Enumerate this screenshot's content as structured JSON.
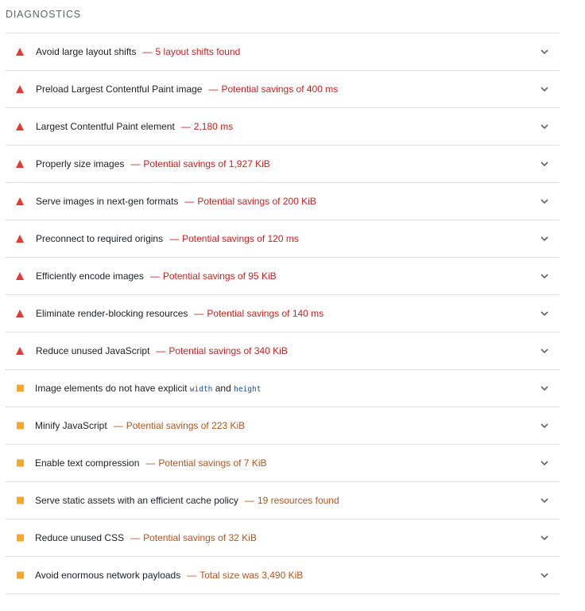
{
  "section": {
    "title": "DIAGNOSTICS"
  },
  "colors": {
    "fail": "#e53935",
    "warn": "#f9a825",
    "fail_text": "#c5221f",
    "warn_text": "#b3541e"
  },
  "audits": [
    {
      "status": "fail",
      "title": "Avoid large layout shifts",
      "separator": "—",
      "display_value": "5 layout shifts found"
    },
    {
      "status": "fail",
      "title": "Preload Largest Contentful Paint image",
      "separator": "—",
      "display_value": "Potential savings of 400 ms"
    },
    {
      "status": "fail",
      "title": "Largest Contentful Paint element",
      "separator": "—",
      "display_value": "2,180 ms"
    },
    {
      "status": "fail",
      "title": "Properly size images",
      "separator": "—",
      "display_value": "Potential savings of 1,927 KiB"
    },
    {
      "status": "fail",
      "title": "Serve images in next-gen formats",
      "separator": "—",
      "display_value": "Potential savings of 200 KiB"
    },
    {
      "status": "fail",
      "title": "Preconnect to required origins",
      "separator": "—",
      "display_value": "Potential savings of 120 ms"
    },
    {
      "status": "fail",
      "title": "Efficiently encode images",
      "separator": "—",
      "display_value": "Potential savings of 95 KiB"
    },
    {
      "status": "fail",
      "title": "Eliminate render-blocking resources",
      "separator": "—",
      "display_value": "Potential savings of 140 ms"
    },
    {
      "status": "fail",
      "title": "Reduce unused JavaScript",
      "separator": "—",
      "display_value": "Potential savings of 340 KiB"
    },
    {
      "status": "warn",
      "title_prefix": "Image elements do not have explicit",
      "code1": "width",
      "title_mid": "and",
      "code2": "height"
    },
    {
      "status": "warn",
      "title": "Minify JavaScript",
      "separator": "—",
      "display_value": "Potential savings of 223 KiB"
    },
    {
      "status": "warn",
      "title": "Enable text compression",
      "separator": "—",
      "display_value": "Potential savings of 7 KiB"
    },
    {
      "status": "warn",
      "title": "Serve static assets with an efficient cache policy",
      "separator": "—",
      "display_value": "19 resources found"
    },
    {
      "status": "warn",
      "title": "Reduce unused CSS",
      "separator": "—",
      "display_value": "Potential savings of 32 KiB"
    },
    {
      "status": "warn",
      "title": "Avoid enormous network payloads",
      "separator": "—",
      "display_value": "Total size was 3,490 KiB"
    }
  ],
  "icons": {
    "fail": "warning-triangle-icon",
    "warn": "warning-square-icon",
    "expand": "chevron-down-icon"
  }
}
